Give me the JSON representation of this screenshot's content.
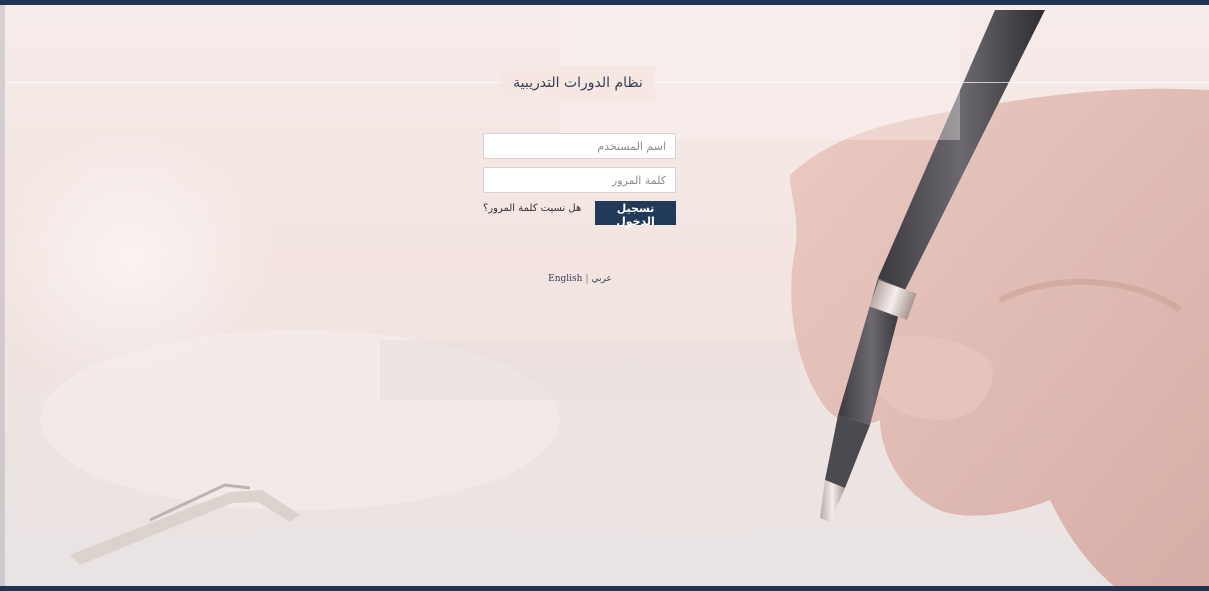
{
  "header": {
    "title": "نظام الدورات التدريبية"
  },
  "login": {
    "username_placeholder": "اسم المستخدم",
    "username_value": "",
    "password_placeholder": "كلمة المرور",
    "password_value": "",
    "submit_label": "تسجيل الدخول",
    "forgot_label": "هل نسيت كلمة المرور؟"
  },
  "language": {
    "english": "English",
    "separator": "|",
    "arabic": "عربي"
  },
  "colors": {
    "accent": "#223a5a",
    "top_bar": "#1f3554",
    "background": "#f3e4e0"
  }
}
